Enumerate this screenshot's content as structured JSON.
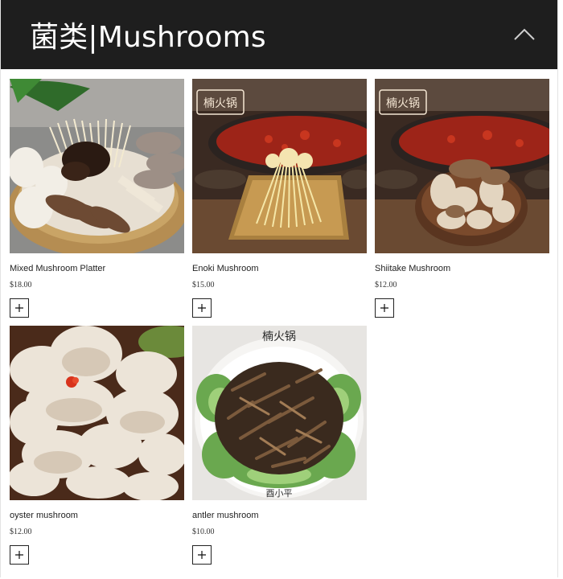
{
  "header": {
    "title": "菌类|Mushrooms",
    "collapse_icon": "chevron-up-icon"
  },
  "products": [
    {
      "name": "Mixed Mushroom Platter",
      "price": "$18.00",
      "add_icon": "plus-icon",
      "image": "mixed-mushroom-platter-photo"
    },
    {
      "name": "Enoki Mushroom",
      "price": "$15.00",
      "add_icon": "plus-icon",
      "image": "enoki-mushroom-photo"
    },
    {
      "name": "Shiitake Mushroom",
      "price": "$12.00",
      "add_icon": "plus-icon",
      "image": "shiitake-mushroom-photo"
    },
    {
      "name": "oyster mushroom",
      "price": "$12.00",
      "add_icon": "plus-icon",
      "image": "oyster-mushroom-photo"
    },
    {
      "name": "antler mushroom",
      "price": "$10.00",
      "add_icon": "plus-icon",
      "image": "antler-mushroom-photo"
    }
  ],
  "colors": {
    "header_bg": "#1e1e1e",
    "header_text": "#ffffff"
  }
}
